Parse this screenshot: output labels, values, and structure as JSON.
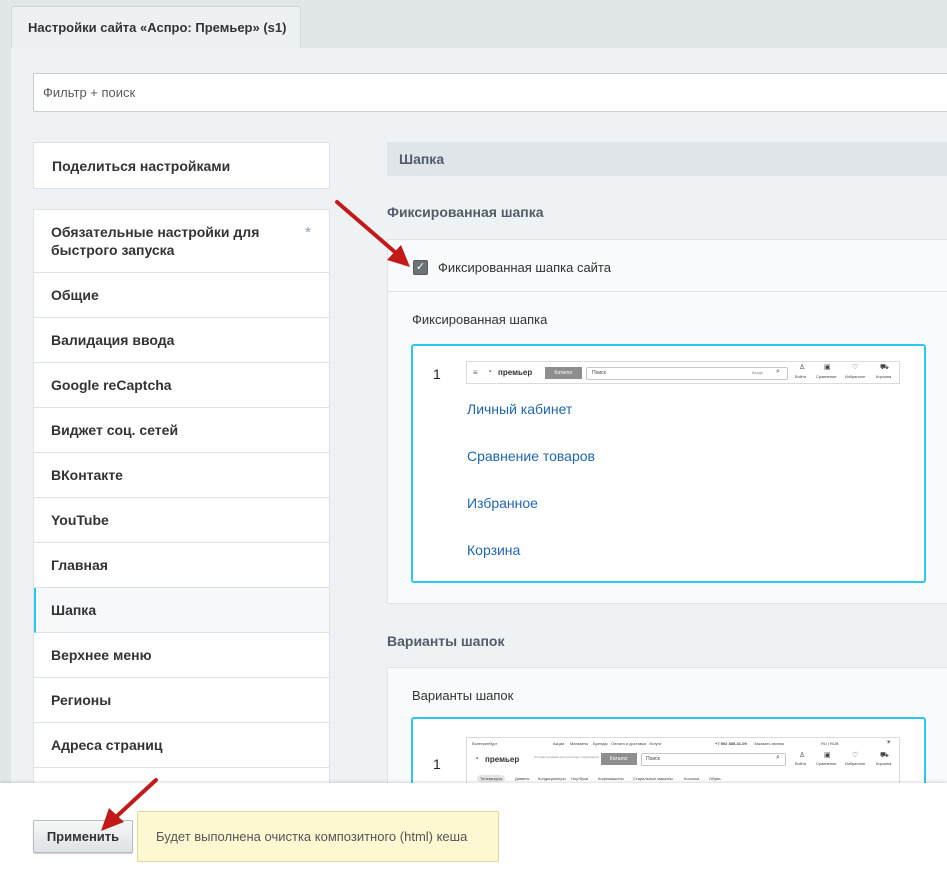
{
  "tab": {
    "title": "Настройки сайта «Аспро: Премьер» (s1)"
  },
  "filter": {
    "placeholder": "Фильтр + поиск"
  },
  "sidebar": {
    "share_label": "Поделиться настройками",
    "items": [
      {
        "label": "Обязательные настройки для быстрого запуска",
        "marker": "*"
      },
      {
        "label": "Общие"
      },
      {
        "label": "Валидация ввода"
      },
      {
        "label": "Google reCaptcha"
      },
      {
        "label": "Виджет соц. сетей"
      },
      {
        "label": "ВКонтакте"
      },
      {
        "label": "YouTube"
      },
      {
        "label": "Главная"
      },
      {
        "label": "Шапка",
        "active": true
      },
      {
        "label": "Верхнее меню"
      },
      {
        "label": "Регионы"
      },
      {
        "label": "Адреса страниц"
      }
    ]
  },
  "main": {
    "section_title": "Шапка",
    "fixed_header": {
      "group_title": "Фиксированная шапка",
      "checkbox_label": "Фиксированная шапка сайта",
      "checkbox_checked": true,
      "panel_title": "Фиксированная шапка",
      "option_number": "1",
      "preview": {
        "logo": "премьер",
        "catalog": "Каталог",
        "search": "Поиск",
        "search_scope": "Везде",
        "icons": [
          "Войти",
          "Сравнение",
          "Избранное",
          "Корзина"
        ]
      },
      "links": [
        "Личный кабинет",
        "Сравнение товаров",
        "Избранное",
        "Корзина"
      ]
    },
    "header_variants": {
      "group_title": "Варианты шапок",
      "panel_title": "Варианты шапок",
      "option_number": "1",
      "preview": {
        "city": "Екатеринбург",
        "top_links": [
          "Акции",
          "Магазины",
          "Бренды",
          "Оплата и доставка",
          "Услуги"
        ],
        "phone": "+7 902 385-41-09",
        "callback": "Заказать звонок",
        "lang": "RU | RUB",
        "logo": "премьер",
        "slogan": "Оптовая продажа для розничных покупателей",
        "catalog": "Каталог",
        "search": "Поиск",
        "icons": [
          "Войти",
          "Сравнение",
          "Избранное",
          "Корзина"
        ],
        "menu": [
          "Телевизоры",
          "Диваны",
          "Кондиционеры",
          "Ноутбуки",
          "Кофемашины",
          "Стиральные машины",
          "Колонки",
          "Обувь"
        ]
      }
    }
  },
  "footer": {
    "apply_label": "Применить",
    "notice": "Будет выполнена очистка композитного (html) кеша"
  },
  "colors": {
    "accent": "#2fc6f6",
    "link": "#2067b0",
    "arrow": "#c21a1a",
    "notice_bg": "#fdf8d2"
  }
}
